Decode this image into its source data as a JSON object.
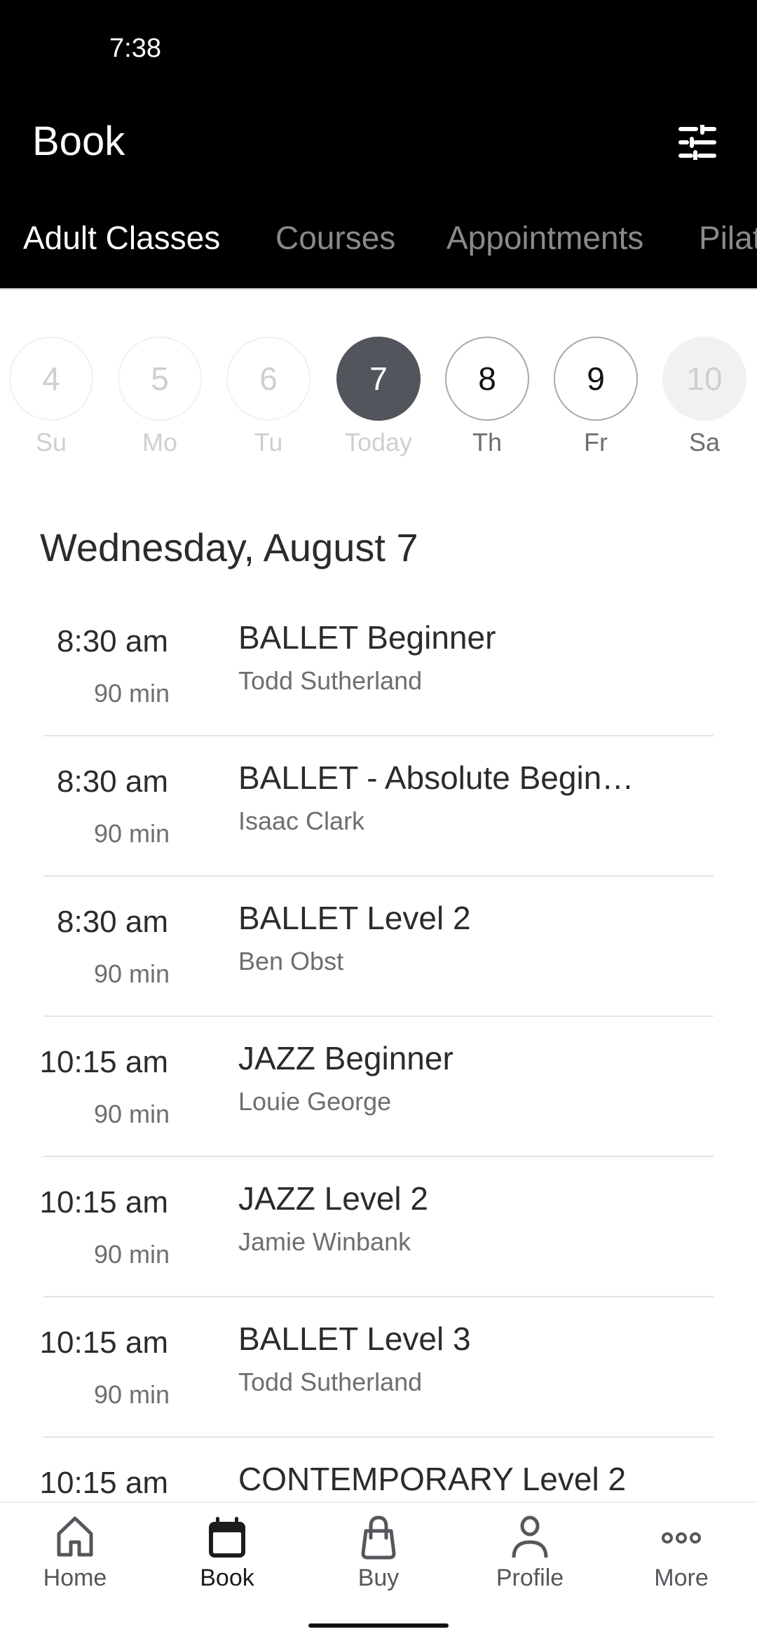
{
  "status_bar": {
    "time": "7:38"
  },
  "header": {
    "title": "Book",
    "filter_icon": "tune-sliders-icon",
    "tabs": [
      {
        "label": "Adult Classes",
        "active": true
      },
      {
        "label": "Courses",
        "active": false
      },
      {
        "label": "Appointments",
        "active": false
      },
      {
        "label": "Pilates",
        "active": false
      }
    ]
  },
  "date_strip": {
    "days": [
      {
        "number": "4",
        "label": "Su",
        "state": "past"
      },
      {
        "number": "5",
        "label": "Mo",
        "state": "past"
      },
      {
        "number": "6",
        "label": "Tu",
        "state": "past"
      },
      {
        "number": "7",
        "label": "Today",
        "state": "selected"
      },
      {
        "number": "8",
        "label": "Th",
        "state": "future"
      },
      {
        "number": "9",
        "label": "Fr",
        "state": "future"
      },
      {
        "number": "10",
        "label": "Sa",
        "state": "unavailable"
      }
    ],
    "selected_color": "#52555c"
  },
  "schedule": {
    "date_heading": "Wednesday, August 7",
    "classes": [
      {
        "time": "8:30 am",
        "duration": "90 min",
        "title": "BALLET Beginner",
        "instructor": "Todd Sutherland"
      },
      {
        "time": "8:30 am",
        "duration": "90 min",
        "title": "BALLET - Absolute Begin…",
        "instructor": "Isaac Clark"
      },
      {
        "time": "8:30 am",
        "duration": "90 min",
        "title": "BALLET Level 2",
        "instructor": "Ben Obst"
      },
      {
        "time": "10:15 am",
        "duration": "90 min",
        "title": "JAZZ Beginner",
        "instructor": "Louie George"
      },
      {
        "time": "10:15 am",
        "duration": "90 min",
        "title": "JAZZ Level 2",
        "instructor": "Jamie Winbank"
      },
      {
        "time": "10:15 am",
        "duration": "90 min",
        "title": "BALLET Level 3",
        "instructor": "Todd Sutherland"
      },
      {
        "time": "10:15 am",
        "duration": "",
        "title": "CONTEMPORARY Level 2",
        "instructor": ""
      }
    ]
  },
  "bottom_nav": {
    "items": [
      {
        "label": "Home",
        "icon": "home-icon",
        "active": false
      },
      {
        "label": "Book",
        "icon": "calendar-icon",
        "active": true
      },
      {
        "label": "Buy",
        "icon": "shopping-bag-icon",
        "active": false
      },
      {
        "label": "Profile",
        "icon": "person-icon",
        "active": false
      },
      {
        "label": "More",
        "icon": "more-dots-icon",
        "active": false
      }
    ]
  }
}
